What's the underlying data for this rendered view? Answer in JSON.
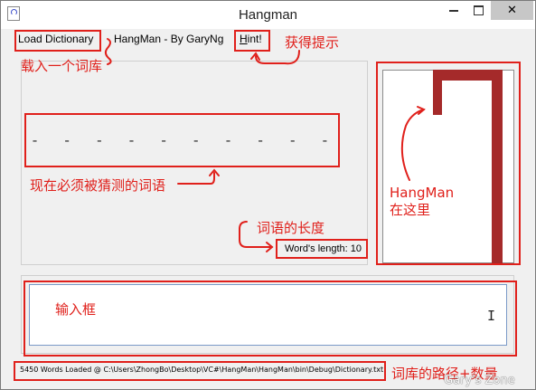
{
  "window": {
    "title": "Hangman"
  },
  "menu": {
    "load_dictionary": "Load Dictionary",
    "app_name": "HangMan - By GaryNg",
    "hint": "Hint!"
  },
  "word": {
    "slots": [
      "-",
      "-",
      "-",
      "-",
      "-",
      "-",
      "-",
      "-",
      "-",
      "-"
    ],
    "length_label": "Word's length: 10"
  },
  "status": {
    "text": "5450 Words Loaded @ C:\\Users\\ZhongBo\\Desktop\\VC#\\HangMan\\HangMan\\bin\\Debug\\Dictionary.txt"
  },
  "annotations": {
    "load_dict": "载入一个词库",
    "hint": "获得提示",
    "word": "现在必须被猜测的词语",
    "length": "词语的长度",
    "hangman_line1": "HangMan",
    "hangman_line2": "在这里",
    "input": "输入框",
    "path": "词库的路径+数量"
  },
  "watermark": "Gary's Zone",
  "colors": {
    "annotation": "#e0201b",
    "gallows": "#a52a2a",
    "input_border": "#7a9ac8"
  }
}
